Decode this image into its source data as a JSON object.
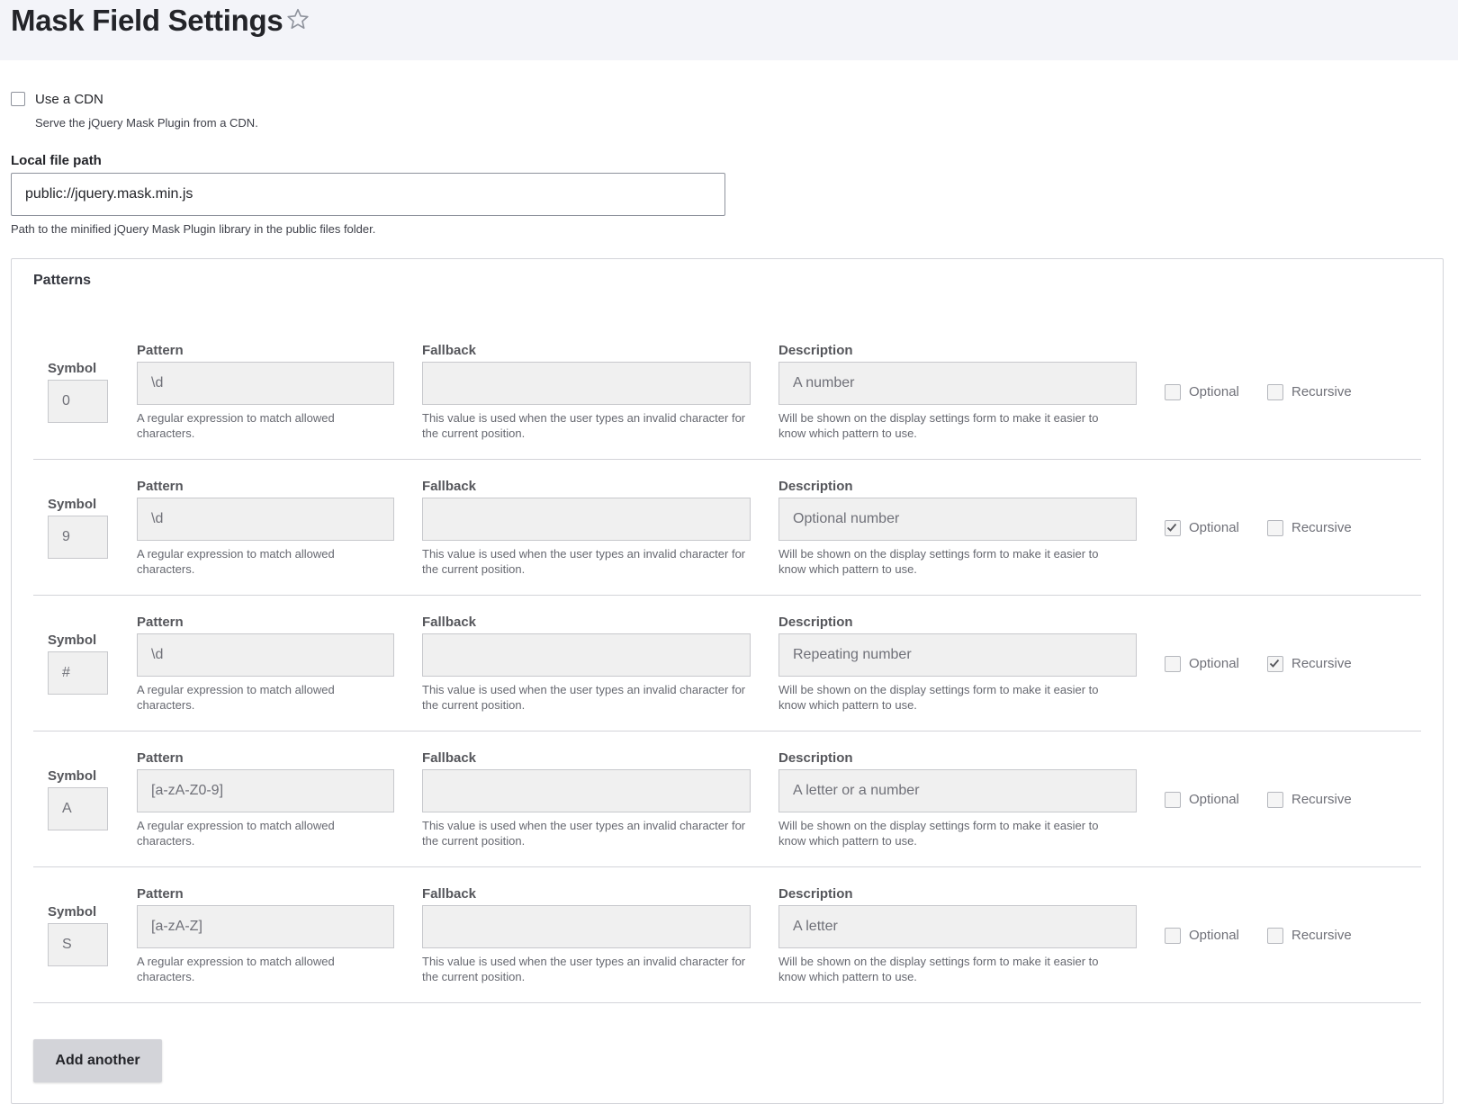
{
  "header": {
    "title": "Mask Field Settings",
    "star_icon": "star-outline-icon"
  },
  "cdn": {
    "label": "Use a CDN",
    "description": "Serve the jQuery Mask Plugin from a CDN.",
    "checked": false
  },
  "local_path": {
    "label": "Local file path",
    "value": "public://jquery.mask.min.js",
    "description": "Path to the minified jQuery Mask Plugin library in the public files folder."
  },
  "patterns": {
    "legend": "Patterns",
    "labels": {
      "symbol": "Symbol",
      "pattern": "Pattern",
      "fallback": "Fallback",
      "description": "Description",
      "optional": "Optional",
      "recursive": "Recursive"
    },
    "help": {
      "pattern": "A regular expression to match allowed characters.",
      "fallback": "This value is used when the user types an invalid character for the current position.",
      "description": "Will be shown on the display settings form to make it easier to know which pattern to use."
    },
    "rows": [
      {
        "symbol": "0",
        "pattern": "\\d",
        "fallback": "",
        "description": "A number",
        "optional": false,
        "recursive": false
      },
      {
        "symbol": "9",
        "pattern": "\\d",
        "fallback": "",
        "description": "Optional number",
        "optional": true,
        "recursive": false
      },
      {
        "symbol": "#",
        "pattern": "\\d",
        "fallback": "",
        "description": "Repeating number",
        "optional": false,
        "recursive": true
      },
      {
        "symbol": "A",
        "pattern": "[a-zA-Z0-9]",
        "fallback": "",
        "description": "A letter or a number",
        "optional": false,
        "recursive": false
      },
      {
        "symbol": "S",
        "pattern": "[a-zA-Z]",
        "fallback": "",
        "description": "A letter",
        "optional": false,
        "recursive": false
      }
    ]
  },
  "add_button": {
    "label": "Add another"
  },
  "colors": {
    "header_bg": "#f3f4f9",
    "disabled_field_bg": "#f0f0f0",
    "button_bg": "#d3d4d9"
  }
}
